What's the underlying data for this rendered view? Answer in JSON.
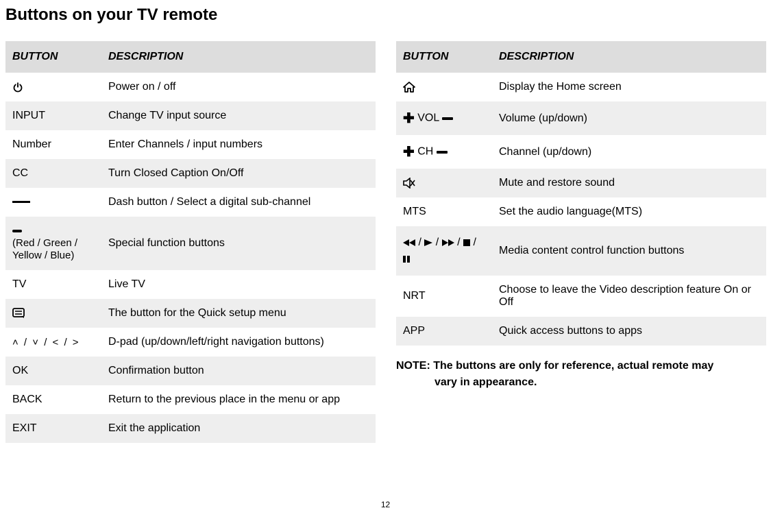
{
  "title": "Buttons on your TV remote",
  "headers": {
    "button": "BUTTON",
    "description": "DESCRIPTION"
  },
  "left": [
    {
      "btn_type": "power",
      "desc": "Power on / off"
    },
    {
      "btn_text": "INPUT",
      "desc": "Change TV input source"
    },
    {
      "btn_text": "Number",
      "desc": "Enter Channels / input numbers"
    },
    {
      "btn_text": "CC",
      "desc": "Turn Closed Caption On/Off"
    },
    {
      "btn_type": "dash",
      "desc": "Dash button / Select a digital sub-channel"
    },
    {
      "btn_type": "color",
      "sub": "(Red / Green / Yellow / Blue)",
      "desc": "Special function buttons"
    },
    {
      "btn_text": "TV",
      "desc": "Live TV"
    },
    {
      "btn_type": "quickmenu",
      "desc": "The button for the Quick setup menu"
    },
    {
      "btn_type": "dpad",
      "dpad_text": "˄ / ˅ / < / >",
      "desc": "D-pad (up/down/left/right navigation buttons)"
    },
    {
      "btn_text": "OK",
      "desc": "Confirmation button"
    },
    {
      "btn_text": "BACK",
      "desc": "Return to the previous place in the menu or app"
    },
    {
      "btn_text": "EXIT",
      "desc": "Exit the application"
    }
  ],
  "right": [
    {
      "btn_type": "home",
      "desc": "Display the Home screen"
    },
    {
      "btn_type": "vol",
      "label": "VOL",
      "desc": "Volume (up/down)"
    },
    {
      "btn_type": "ch",
      "label": "CH",
      "desc": "Channel (up/down)"
    },
    {
      "btn_type": "mute",
      "desc": "Mute and restore sound"
    },
    {
      "btn_text": "MTS",
      "desc": "Set the audio language(MTS)"
    },
    {
      "btn_type": "media",
      "desc": "Media content control function buttons"
    },
    {
      "btn_text": "NRT",
      "desc": "Choose to leave the Video description feature On or Off"
    },
    {
      "btn_text": "APP",
      "desc": "Quick access buttons to apps"
    }
  ],
  "note_label": "NOTE:",
  "note_line1": "The buttons are only for reference, actual remote may",
  "note_line2": "vary in appearance.",
  "page_number": "12"
}
